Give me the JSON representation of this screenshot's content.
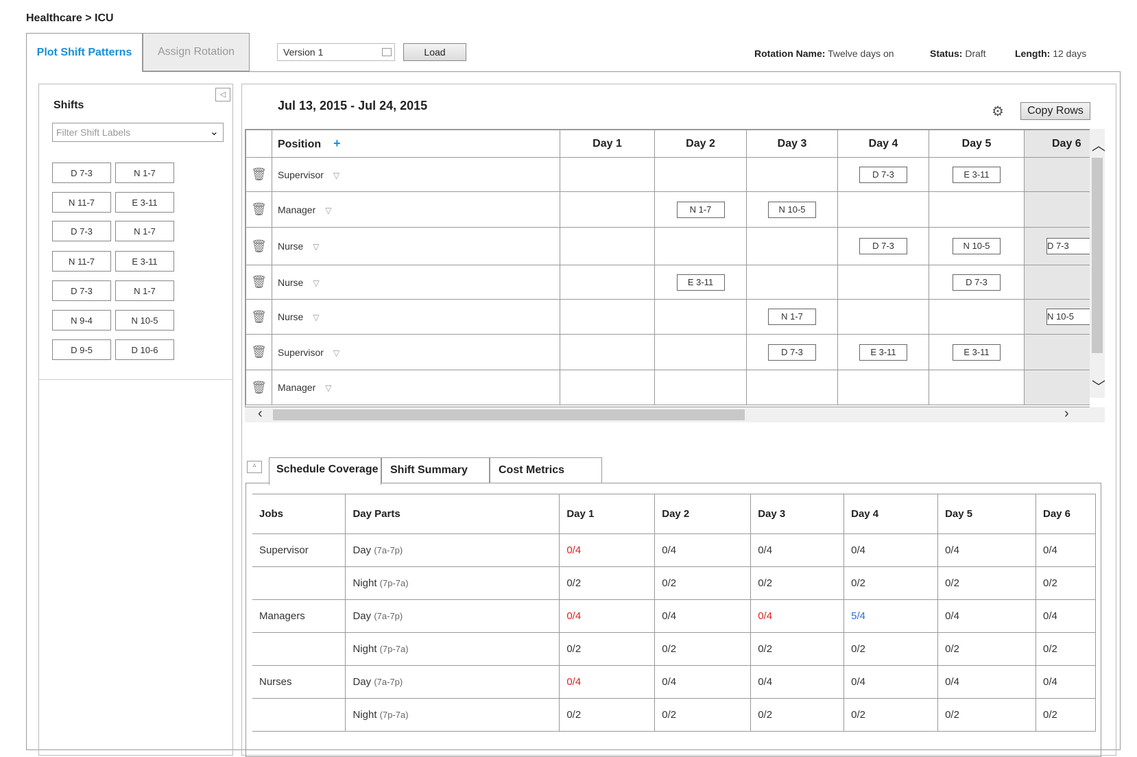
{
  "breadcrumb": "Healthcare > ICU",
  "tabs": {
    "plot": "Plot Shift Patterns",
    "assign": "Assign Rotation"
  },
  "version": {
    "value": "Version 1"
  },
  "load_label": "Load",
  "meta": {
    "rotation_label": "Rotation Name:",
    "rotation_value": "Twelve days on",
    "status_label": "Status:",
    "status_value": "Draft",
    "length_label": "Length:",
    "length_value": "12 days"
  },
  "shifts_panel": {
    "title": "Shifts",
    "filter_placeholder": "Filter Shift Labels",
    "chips": [
      [
        "D 7-3",
        "N 1-7"
      ],
      [
        "N 11-7",
        "E 3-11"
      ],
      [
        "D 7-3",
        "N 1-7"
      ],
      [
        "N 11-7",
        "E 3-11"
      ],
      [
        "D 7-3",
        "N 1-7"
      ],
      [
        "N 9-4",
        "N 10-5"
      ],
      [
        "D 9-5",
        "D 10-6"
      ]
    ]
  },
  "grid": {
    "date_range": "Jul 13, 2015 - Jul 24, 2015",
    "copy_rows_label": "Copy Rows",
    "position_header": "Position",
    "day_headers": [
      "Day 1",
      "Day 2",
      "Day 3",
      "Day 4",
      "Day 5",
      "Day 6"
    ],
    "rows": [
      {
        "position": "Supervisor",
        "cells": [
          "",
          "",
          "",
          "D 7-3",
          "E 3-11",
          ""
        ]
      },
      {
        "position": "Manager",
        "cells": [
          "",
          "N 1-7",
          "N 10-5",
          "",
          "",
          ""
        ]
      },
      {
        "position": "Nurse",
        "cells": [
          "",
          "",
          "",
          "D 7-3",
          "N 10-5",
          "D 7-3"
        ]
      },
      {
        "position": "Nurse",
        "cells": [
          "",
          "E 3-11",
          "",
          "",
          "D 7-3",
          ""
        ]
      },
      {
        "position": "Nurse",
        "cells": [
          "",
          "",
          "N 1-7",
          "",
          "",
          "N 10-5"
        ]
      },
      {
        "position": "Supervisor",
        "cells": [
          "",
          "",
          "D 7-3",
          "E 3-11",
          "E 3-11",
          ""
        ]
      },
      {
        "position": "Manager",
        "cells": [
          "",
          "",
          "",
          "",
          "",
          ""
        ]
      }
    ]
  },
  "bottom_tabs": [
    "Schedule Coverage",
    "Shift Summary",
    "Cost Metrics"
  ],
  "coverage": {
    "headers": [
      "Jobs",
      "Day Parts",
      "Day 1",
      "Day 2",
      "Day 3",
      "Day 4",
      "Day 5",
      "Day 6"
    ],
    "rows": [
      {
        "job": "Supervisor",
        "part": "Day",
        "hours": "(7a-7p)",
        "vals": [
          "0/4",
          "0/4",
          "0/4",
          "0/4",
          "0/4",
          "0/4"
        ],
        "status": [
          "red",
          "",
          "",
          "",
          "",
          ""
        ]
      },
      {
        "job": "",
        "part": "Night",
        "hours": "(7p-7a)",
        "vals": [
          "0/2",
          "0/2",
          "0/2",
          "0/2",
          "0/2",
          "0/2"
        ],
        "status": [
          "",
          "",
          "",
          "",
          "",
          ""
        ]
      },
      {
        "job": "Managers",
        "part": "Day",
        "hours": "(7a-7p)",
        "vals": [
          "0/4",
          "0/4",
          "0/4",
          "5/4",
          "0/4",
          "0/4"
        ],
        "status": [
          "red",
          "",
          "red",
          "blue",
          "",
          ""
        ]
      },
      {
        "job": "",
        "part": "Night",
        "hours": "(7p-7a)",
        "vals": [
          "0/2",
          "0/2",
          "0/2",
          "0/2",
          "0/2",
          "0/2"
        ],
        "status": [
          "",
          "",
          "",
          "",
          "",
          ""
        ]
      },
      {
        "job": "Nurses",
        "part": "Day",
        "hours": "(7a-7p)",
        "vals": [
          "0/4",
          "0/4",
          "0/4",
          "0/4",
          "0/4",
          "0/4"
        ],
        "status": [
          "red",
          "",
          "",
          "",
          "",
          ""
        ]
      },
      {
        "job": "",
        "part": "Night",
        "hours": "(7p-7a)",
        "vals": [
          "0/2",
          "0/2",
          "0/2",
          "0/2",
          "0/2",
          "0/2"
        ],
        "status": [
          "",
          "",
          "",
          "",
          "",
          ""
        ]
      }
    ]
  }
}
